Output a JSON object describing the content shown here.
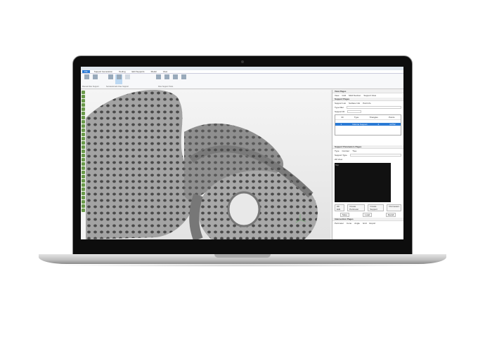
{
  "menu": {
    "tabs": [
      "File",
      "Support Generation",
      "Tooling",
      "Edit Supports",
      "Model",
      "View"
    ],
    "active": 0
  },
  "ribbon": {
    "groups": [
      "Manual Files Support",
      "Semiautomatic Files Support",
      "Files Support Tools"
    ]
  },
  "panel": {
    "view_pages": {
      "title": "View Pages",
      "tabs": [
        "View",
        "Grid",
        "Multi Section",
        "Support View"
      ]
    },
    "support_pages": {
      "title": "Support Pages",
      "tabs": [
        "Support List",
        "Surface Info",
        "Part Info"
      ],
      "type_filter": "Type filter",
      "support_id": "Support ID",
      "list_cols": [
        "ID",
        "Type",
        "Triangles",
        "Points"
      ],
      "selected_row": [
        "1",
        "Volume Support",
        "4",
        "12752"
      ]
    },
    "support_params": {
      "title": "Support Parameters Pages",
      "tabs": [
        "Type",
        "Contour",
        "Tree"
      ],
      "support_type": "Support Type",
      "preview_label": "2D View",
      "preview_text": "Top",
      "buttons": [
        "2D Edit",
        "Create Perimeter",
        "Create Support",
        "Perimeters",
        "Save",
        "Load",
        "Recall"
      ]
    },
    "generation": {
      "title": "Intersection Pages",
      "tabs": [
        "Perimeter",
        "Cone",
        "Angle",
        "Grid",
        "Export"
      ]
    }
  },
  "colors": {
    "accent": "#2a7ad5",
    "preview_bg": "#111111",
    "model": "#9a9a9a"
  }
}
